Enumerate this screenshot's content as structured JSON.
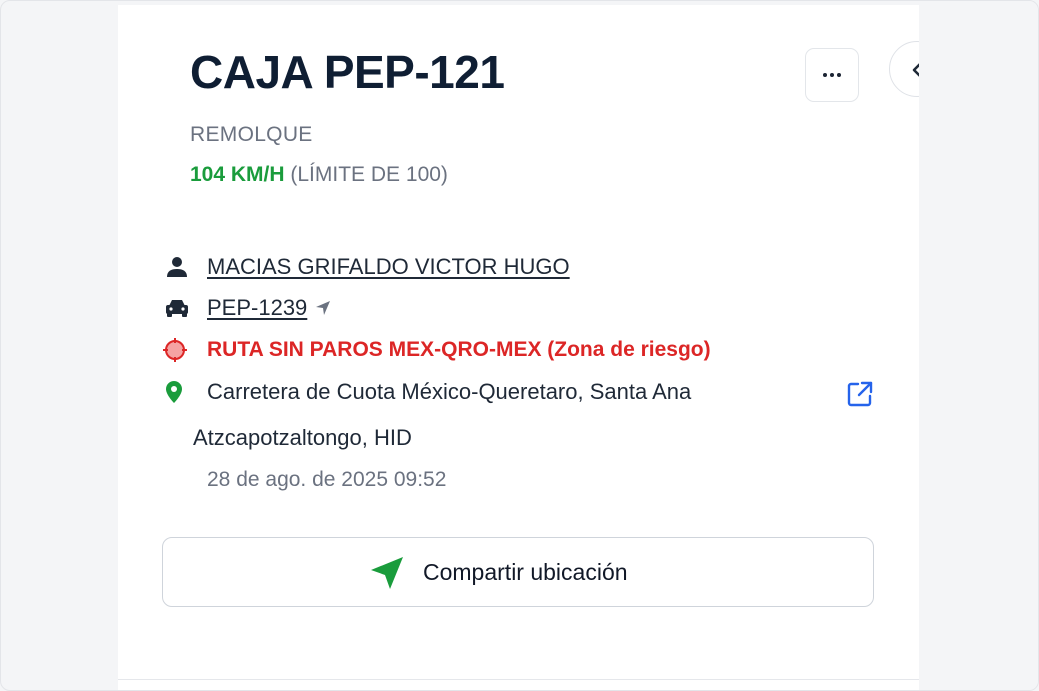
{
  "header": {
    "title": "CAJA PEP-121",
    "type_label": "REMOLQUE",
    "speed": "104 KM/H",
    "speed_limit": "(LÍMITE DE 100)"
  },
  "details": {
    "driver": "MACIAS GRIFALDO VICTOR HUGO",
    "vehicle": "PEP-1239",
    "route": "RUTA SIN PAROS MEX-QRO-MEX (Zona de riesgo)",
    "address_line1": "Carretera de Cuota México-Queretaro, Santa Ana",
    "address_line2": "Atzcapotzaltongo, HID",
    "timestamp": "28 de ago. de 2025 09:52"
  },
  "actions": {
    "share_label": "Compartir ubicación"
  },
  "colors": {
    "speed": "#1a9c3c",
    "route_alert": "#dc2626",
    "location_pin": "#1a9c3c",
    "external_link": "#2563eb",
    "title": "#0f1e33"
  },
  "icons": {
    "driver": "person-icon",
    "vehicle": "car-icon",
    "route": "geofence-target-icon",
    "address": "location-pin-icon",
    "open_map": "external-link-icon",
    "share": "navigation-arrow-icon",
    "more": "more-horizontal-icon",
    "collapse": "chevron-left-icon"
  }
}
